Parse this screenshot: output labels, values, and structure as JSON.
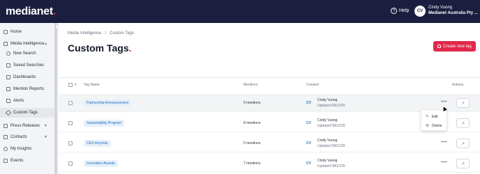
{
  "header": {
    "logo_text": "medianet",
    "logo_dot": ".",
    "help_label": "Help",
    "help_icon": "?",
    "avatar_initials": "CV",
    "user_name": "Cindy Vuong",
    "user_org": "Medianet Australia Pty ..."
  },
  "sidebar": {
    "collapse_icon": "‹",
    "items": [
      {
        "label": "Home",
        "icon": "home-icon",
        "level": 0
      },
      {
        "label": "Media Intelligence",
        "icon": "media-icon",
        "level": 0,
        "expanded": true
      },
      {
        "label": "New Search",
        "icon": "search-icon",
        "level": 1
      },
      {
        "label": "Saved Searches",
        "icon": "bookmark-icon",
        "level": 1
      },
      {
        "label": "Dashboards",
        "icon": "dashboard-icon",
        "level": 1
      },
      {
        "label": "Mention Reports",
        "icon": "report-icon",
        "level": 1
      },
      {
        "label": "Alerts",
        "icon": "bell-icon",
        "level": 1
      },
      {
        "label": "Custom Tags",
        "icon": "tag-icon",
        "level": 1,
        "active": true
      },
      {
        "label": "Press Releases",
        "icon": "press-icon",
        "level": 0
      },
      {
        "label": "Contacts",
        "icon": "contacts-icon",
        "level": 0
      },
      {
        "label": "My Insights",
        "icon": "insights-icon",
        "level": 0
      },
      {
        "label": "Events",
        "icon": "events-icon",
        "level": 0
      }
    ]
  },
  "breadcrumb": {
    "parent": "Media Intelligence",
    "separator": "/",
    "current": "Custom Tags"
  },
  "page": {
    "title": "Custom Tags",
    "title_dot": ".",
    "create_button": "Create new tag"
  },
  "table": {
    "columns": [
      "Tag Name",
      "Mentions",
      "Created",
      "Actions"
    ],
    "rows": [
      {
        "tag": "Partnership Announcement",
        "mentions": "6 mentions",
        "initials": "CV",
        "creator": "Cindy Vuong",
        "updated": "Updated 08/12/25"
      },
      {
        "tag": "Sustainability Program",
        "mentions": "8 mentions",
        "initials": "CV",
        "creator": "Cindy Vuong",
        "updated": "Updated 08/12/25"
      },
      {
        "tag": "CEO Keynote",
        "mentions": "5 mentions",
        "initials": "CV",
        "creator": "Cindy Vuong",
        "updated": "Updated 08/12/25"
      },
      {
        "tag": "Innovation Awards",
        "mentions": "7 mentions",
        "initials": "CV",
        "creator": "Cindy Vuong",
        "updated": "Updated 08/12/25"
      }
    ],
    "more_icon": "•••",
    "action_icon": "↗"
  },
  "context_menu": {
    "edit": "Edit",
    "delete": "Delete"
  },
  "colors": {
    "brand": "#1b1e3f",
    "accent": "#e0284a",
    "tag_bg": "#e7f0fa",
    "tag_text": "#1d6fb8"
  }
}
